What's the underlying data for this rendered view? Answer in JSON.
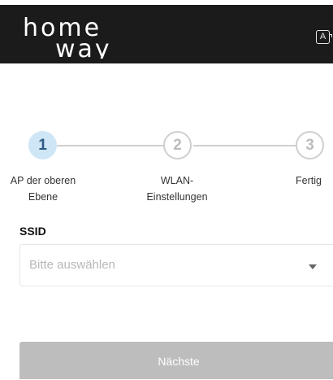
{
  "header": {
    "logo_line1": "home",
    "logo_line2": "way",
    "lang_icon_label": "A",
    "lang_icon_name": "language-icon"
  },
  "stepper": {
    "current_step": 1,
    "steps": [
      {
        "number": "1",
        "label": "AP der oberen\nEbene"
      },
      {
        "number": "2",
        "label": "WLAN-\nEinstellungen"
      },
      {
        "number": "3",
        "label": "Fertig"
      }
    ]
  },
  "form": {
    "ssid_label": "SSID",
    "ssid_placeholder": "Bitte auswählen"
  },
  "actions": {
    "next_label": "Nächste"
  },
  "colors": {
    "header_bg": "#1b1b1b",
    "step_active_bg": "#cfe6f6",
    "step_active_text": "#2d5b86",
    "button_disabled_bg": "#bdbdbd"
  }
}
